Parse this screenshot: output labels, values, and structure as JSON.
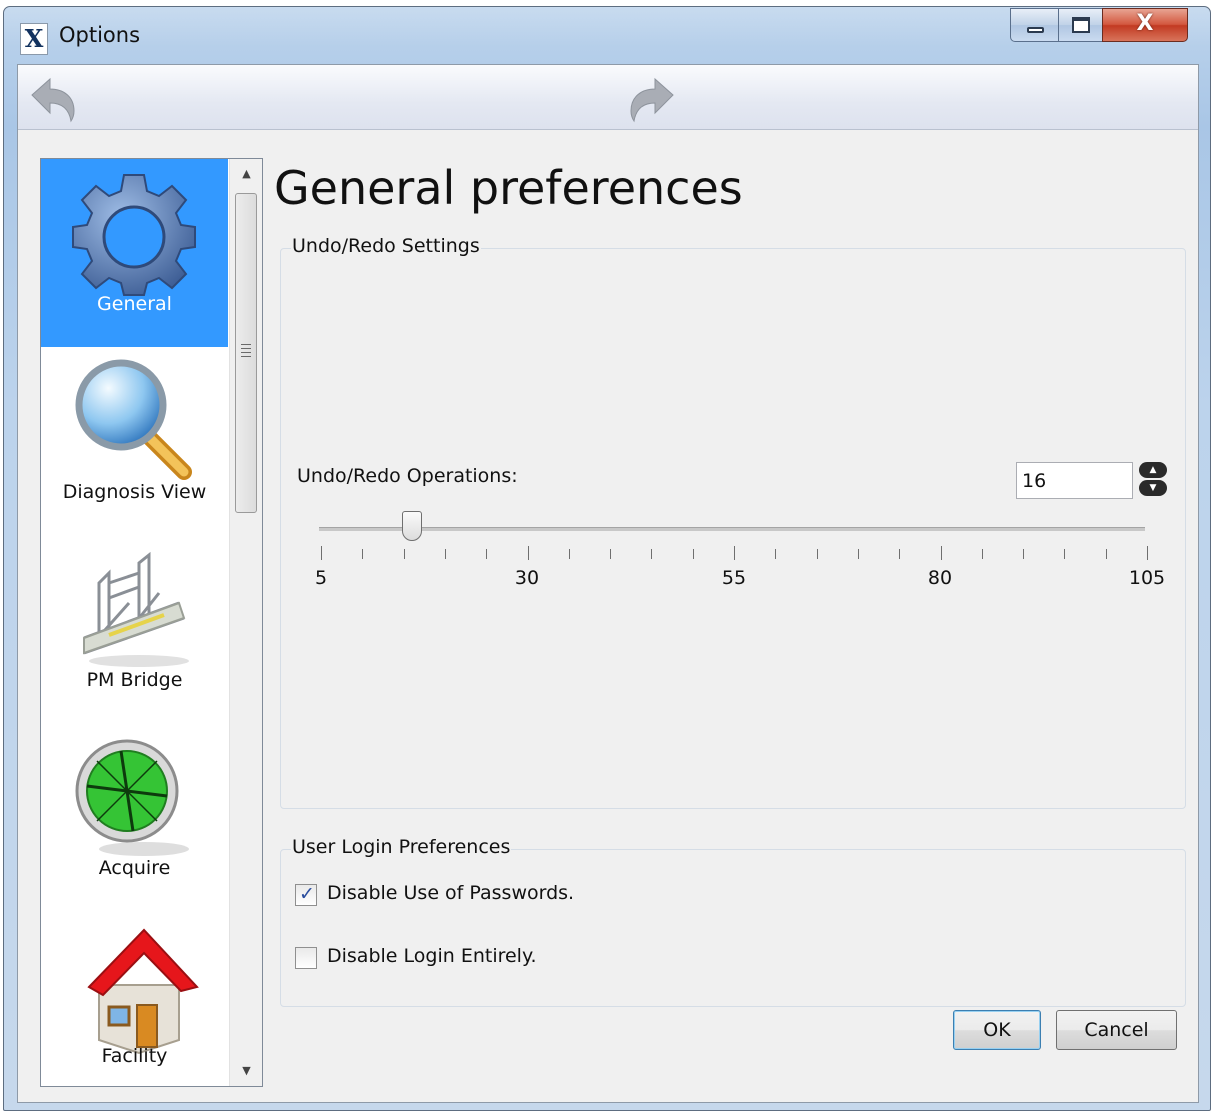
{
  "window": {
    "title": "Options",
    "app_icon_glyph": "X",
    "buttons": {
      "minimize": "minimize-icon",
      "maximize": "maximize-icon",
      "close_glyph": "X"
    }
  },
  "navbar": {
    "back_icon": "back-arrow-icon",
    "forward_icon": "forward-arrow-icon"
  },
  "sidebar": {
    "items": [
      {
        "label": "General",
        "icon": "gear-icon",
        "selected": true
      },
      {
        "label": "Diagnosis View",
        "icon": "magnifier-icon",
        "selected": false
      },
      {
        "label": "PM Bridge",
        "icon": "bridge-icon",
        "selected": false
      },
      {
        "label": "Acquire",
        "icon": "target-icon",
        "selected": false
      },
      {
        "label": "Facility",
        "icon": "house-icon",
        "selected": false
      }
    ]
  },
  "page": {
    "title": "General preferences"
  },
  "undo_group": {
    "legend": "Undo/Redo Settings",
    "ops_label": "Undo/Redo Operations:",
    "ops_value": "16",
    "slider": {
      "min": 5,
      "max": 105,
      "value": 16,
      "tick_labels": [
        "5",
        "30",
        "55",
        "80",
        "105"
      ]
    }
  },
  "login_group": {
    "legend": "User Login Preferences",
    "disable_passwords": {
      "label": "Disable Use of Passwords.",
      "checked": true
    },
    "disable_login": {
      "label": "Disable Login Entirely.",
      "checked": false
    }
  },
  "footer": {
    "ok_label": "OK",
    "cancel_label": "Cancel"
  },
  "colors": {
    "selection": "#3399ff",
    "title_bar": "#b6cfea",
    "close_button": "#c23a22"
  }
}
